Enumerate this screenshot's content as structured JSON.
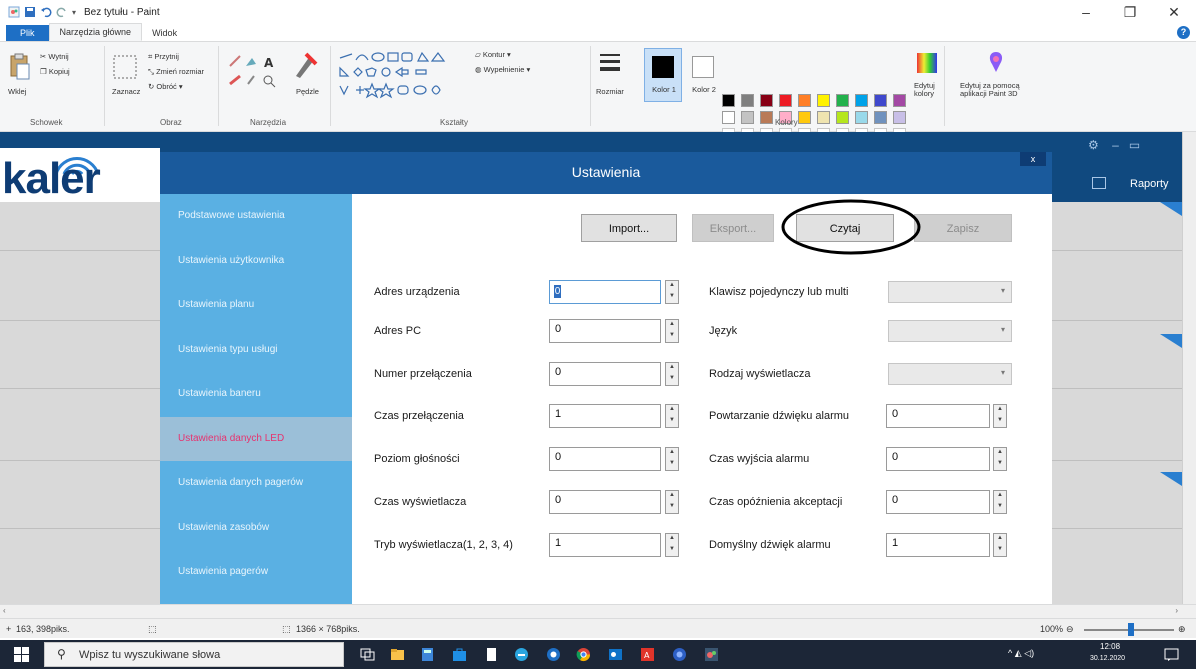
{
  "paint": {
    "title": "Bez tytułu - Paint",
    "tabs": {
      "file": "Plik",
      "home": "Narzędzia główne",
      "view": "Widok"
    },
    "clipboard": {
      "paste": "Wklej",
      "cut": "Wytnij",
      "copy": "Kopiuj",
      "label": "Schowek"
    },
    "image": {
      "select": "Zaznacz",
      "crop": "Przytnij",
      "resize": "Zmień rozmiar",
      "rotate": "Obróć",
      "label": "Obraz"
    },
    "tools": {
      "brushes": "Pędzle",
      "label": "Narzędzia"
    },
    "shapes": {
      "outline": "Kontur",
      "fill": "Wypełnienie",
      "label": "Kształty"
    },
    "size_label": "Rozmiar",
    "colors": {
      "color1": "Kolor 1",
      "color2": "Kolor 2",
      "edit": "Edytuj kolory",
      "label": "Kolory",
      "palette_row1": [
        "#000000",
        "#7f7f7f",
        "#880015",
        "#ed1c24",
        "#ff7f27",
        "#fff200",
        "#22b14c",
        "#00a2e8",
        "#3f48cc",
        "#a349a4"
      ],
      "palette_row2": [
        "#ffffff",
        "#c3c3c3",
        "#b97a57",
        "#ffaec9",
        "#ffc90e",
        "#efe4b0",
        "#b5e61d",
        "#99d9ea",
        "#7092be",
        "#c8bfe7"
      ]
    },
    "paint3d": "Edytuj za pomocą aplikacji Paint 3D",
    "status": {
      "cursor": "163, 398piks.",
      "canvas": "1366 × 768piks.",
      "zoom": "100%"
    }
  },
  "app": {
    "brand": "kaler",
    "reports": "Raporty"
  },
  "dialog": {
    "title": "Ustawienia",
    "close": "x",
    "sidebar": [
      {
        "label": "Podstawowe ustawienia"
      },
      {
        "label": "Ustawienia użytkownika"
      },
      {
        "label": "Ustawienia planu"
      },
      {
        "label": "Ustawienia typu usługi"
      },
      {
        "label": "Ustawienia baneru"
      },
      {
        "label": "Ustawienia danych LED"
      },
      {
        "label": "Ustawienia danych pagerów"
      },
      {
        "label": "Ustawienia zasobów"
      },
      {
        "label": "Ustawienia pagerów"
      }
    ],
    "active_index": 5,
    "buttons": {
      "import": "Import...",
      "export": "Eksport...",
      "read": "Czytaj",
      "save": "Zapisz"
    },
    "left_fields": [
      {
        "label": "Adres urządzenia",
        "value": "0"
      },
      {
        "label": "Adres PC",
        "value": "0"
      },
      {
        "label": "Numer przełączenia",
        "value": "0"
      },
      {
        "label": "Czas przełączenia",
        "value": "1"
      },
      {
        "label": "Poziom głośności",
        "value": "0"
      },
      {
        "label": "Czas wyświetlacza",
        "value": "0"
      },
      {
        "label": "Tryb wyświetlacza(1, 2, 3, 4)",
        "value": "1"
      }
    ],
    "right_fields": [
      {
        "label": "Klawisz pojedynczy lub multi",
        "kind": "combo",
        "value": ""
      },
      {
        "label": "Język",
        "kind": "combo",
        "value": ""
      },
      {
        "label": "Rodzaj wyświetlacza",
        "kind": "combo",
        "value": ""
      },
      {
        "label": "Powtarzanie dźwięku alarmu",
        "kind": "spin",
        "value": "0"
      },
      {
        "label": "Czas wyjścia alarmu",
        "kind": "spin",
        "value": "0"
      },
      {
        "label": "Czas opóźnienia akceptacji",
        "kind": "spin",
        "value": "0"
      },
      {
        "label": "Domyślny dźwięk alarmu",
        "kind": "spin",
        "value": "1"
      }
    ]
  },
  "taskbar": {
    "search_placeholder": "Wpisz tu wyszukiwane słowa",
    "time": "12:08",
    "date": "30.12.2020"
  }
}
